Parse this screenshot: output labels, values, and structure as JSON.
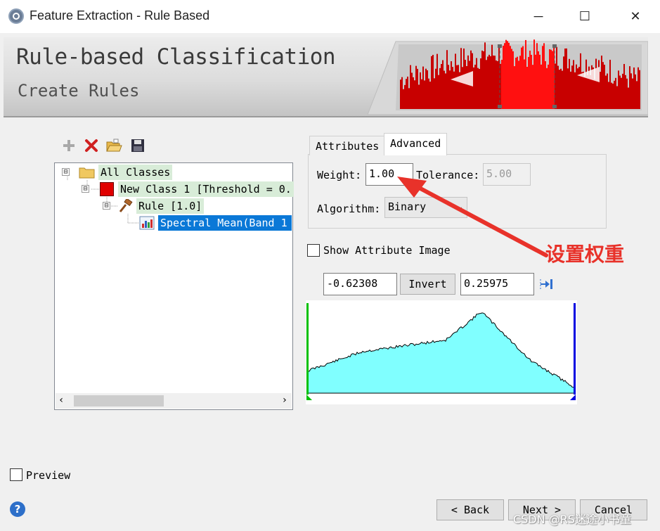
{
  "window": {
    "title": "Feature Extraction - Rule Based",
    "minimize_glyph": "─",
    "maximize_glyph": "☐",
    "close_glyph": "✕"
  },
  "banner": {
    "title": "Rule-based Classification",
    "subtitle": "Create Rules"
  },
  "toolbar": {
    "icons": [
      "add-icon",
      "delete-icon",
      "open-folder-icon",
      "save-icon"
    ]
  },
  "tree": {
    "root": {
      "label": "All Classes",
      "expander": "⊟"
    },
    "class": {
      "label": "New Class 1 [Threshold = 0.",
      "expander": "⊟",
      "color": "#e00000"
    },
    "rule": {
      "label": "Rule [1.0]",
      "expander": "⊟"
    },
    "attribute": {
      "label": "Spectral Mean(Band 1"
    }
  },
  "tabs": [
    {
      "label": "Attributes",
      "active": false
    },
    {
      "label": "Advanced",
      "active": true
    }
  ],
  "advanced": {
    "weight_label": "Weight:",
    "weight_value": "1.00",
    "tolerance_label": "Tolerance:",
    "tolerance_value": "5.00",
    "algorithm_label": "Algorithm:",
    "algorithm_value": "Binary"
  },
  "attribute_image": {
    "show_label": "Show Attribute Image",
    "checked": false
  },
  "threshold": {
    "min_value": "-0.62308",
    "invert_label": "Invert",
    "max_value": "0.25975"
  },
  "histogram": {
    "fill_color": "#80ffff",
    "min_marker_color": "#00c000",
    "max_marker_color": "#0000e0"
  },
  "preview": {
    "label": "Preview",
    "checked": false
  },
  "footer": {
    "back_label": "< Back",
    "next_label": "Next >",
    "cancel_label": "Cancel"
  },
  "annotation": {
    "text": "设置权重",
    "color": "#e8322a"
  },
  "watermark": "CSDN @RS迷途小书童"
}
